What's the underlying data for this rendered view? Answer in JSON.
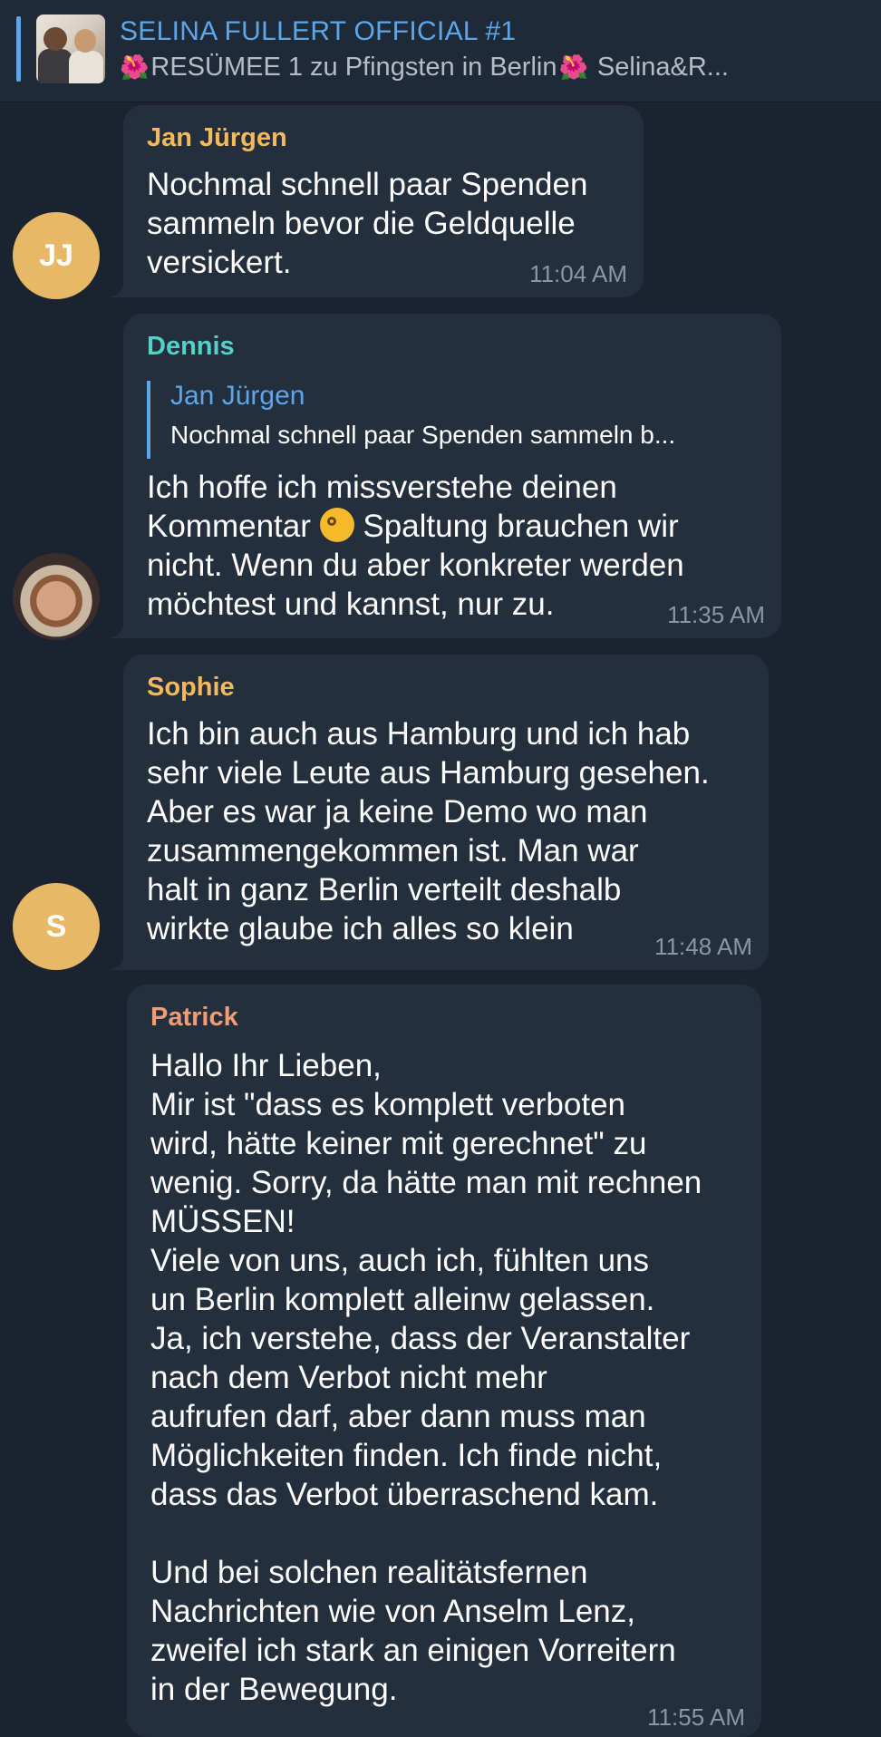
{
  "pinned": {
    "title": "SELINA FULLERT OFFICIAL #1",
    "flower_icon": "🌺",
    "subtitle_a": "RESÜMEE 1 zu Pfingsten in Berlin",
    "subtitle_b": " Selina&R..."
  },
  "messages": [
    {
      "sender": "Jan Jürgen",
      "sender_color": "#f3b95a",
      "avatar_initials": "JJ",
      "avatar_color": "#e7b865",
      "text": "Nochmal schnell paar Spenden\nsammeln bevor die Geldquelle\nversickert.",
      "time": "11:04 AM"
    },
    {
      "sender": "Dennis",
      "sender_color": "#53d2c8",
      "reply": {
        "name": "Jan Jürgen",
        "text": "Nochmal schnell paar Spenden sammeln b..."
      },
      "text_before_emoji": "Ich hoffe ich missverstehe deinen\nKommentar ",
      "emoji": "face-with-monocle",
      "text_after_emoji": " Spaltung brauchen wir\nnicht. Wenn du aber konkreter werden\nmöchtest und kannst, nur zu.",
      "time": "11:35 AM"
    },
    {
      "sender": "Sophie",
      "sender_color": "#f3b95a",
      "avatar_initials": "S",
      "avatar_color": "#e7b865",
      "text": "Ich bin auch aus Hamburg und ich hab\nsehr viele Leute aus Hamburg gesehen.\nAber es war ja keine Demo wo man\nzusammengekommen ist. Man war\nhalt in ganz Berlin verteilt deshalb\nwirkte glaube ich alles so klein",
      "time": "11:48 AM"
    },
    {
      "sender": "Patrick",
      "sender_color": "#ee9d76",
      "text": "Hallo Ihr Lieben,\nMir ist \"dass es komplett verboten\nwird, hätte keiner mit gerechnet\" zu\nwenig. Sorry, da hätte man mit rechnen\nMÜSSEN!\nViele von uns, auch ich, fühlten uns\nun Berlin komplett alleinw gelassen.\nJa, ich verstehe, dass der Veranstalter\nnach dem Verbot nicht mehr\naufrufen darf, aber dann muss man\nMöglichkeiten finden. Ich finde nicht,\ndass das Verbot überraschend kam.\n\nUnd bei solchen realitätsfernen\nNachrichten wie von Anselm Lenz,\nzweifel ich stark an einigen Vorreitern\nin der Bewegung.",
      "time": "11:55 AM"
    }
  ]
}
